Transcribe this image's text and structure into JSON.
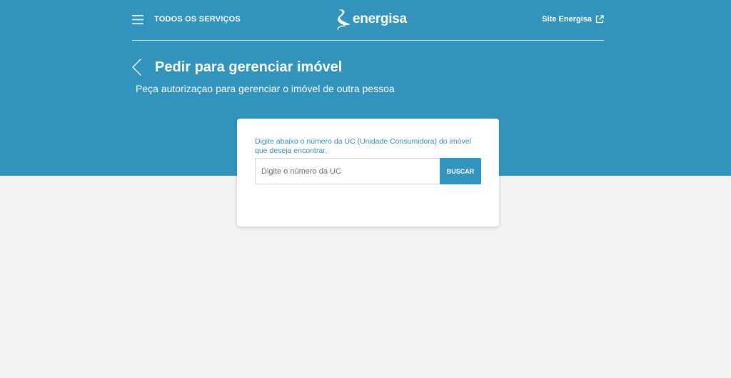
{
  "header": {
    "menu_label": "TODOS OS SERVIÇOS",
    "logo_text": "energisa",
    "site_link_label": "Site Energisa"
  },
  "page": {
    "title": "Pedir para gerenciar imóvel",
    "subtitle": "Peça autorizaçao para gerenciar o imóvel de outra pessoa"
  },
  "form": {
    "instruction": "Digite abaixo o número da UC (Unidade Consumidora) do imóvel que deseja encontrar.",
    "uc_placeholder": "Digite o número da UC",
    "uc_value": "",
    "search_label": "BUSCAR"
  },
  "colors": {
    "primary": "#3294bd",
    "background": "#f2f2f2",
    "card": "#ffffff"
  },
  "icons": {
    "menu": "hamburger-icon",
    "logo": "energisa-logo-icon",
    "external": "external-link-icon",
    "back": "chevron-left-icon"
  }
}
